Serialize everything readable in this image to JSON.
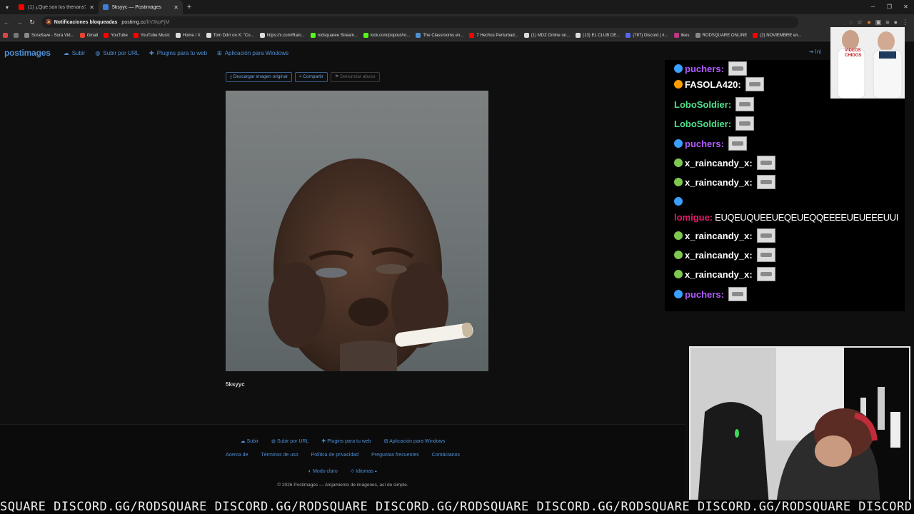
{
  "browser": {
    "tabs": [
      {
        "title": "(1) ¿Qué son los therians? - Yo",
        "favicon_color": "#ff0000",
        "active": false
      },
      {
        "title": "5ksyyc — Postimages",
        "favicon_color": "#3d7ed8",
        "active": true
      }
    ],
    "omnibox": {
      "blocked_label": "Notificaciones bloqueadas",
      "url_host": "postimg.cc",
      "url_path": "/kV3kpPjM"
    },
    "bookmarks": [
      {
        "label": "SoraSave - Sora Vid...",
        "icon_color": "#888888"
      },
      {
        "label": "Gmail",
        "icon_color": "#ea4335"
      },
      {
        "label": "YouTube",
        "icon_color": "#ff0000"
      },
      {
        "label": "YouTube Music",
        "icon_color": "#ff0000"
      },
      {
        "label": "Home / X",
        "icon_color": "#dddddd"
      },
      {
        "label": "Tom Ddrr on X: \"Co...",
        "icon_color": "#dddddd"
      },
      {
        "label": "https://x.com/Rain...",
        "icon_color": "#dddddd"
      },
      {
        "label": "rodsquaree Stream...",
        "icon_color": "#53fc18"
      },
      {
        "label": "kick.com/popout/ro...",
        "icon_color": "#53fc18"
      },
      {
        "label": "The Classrooms en...",
        "icon_color": "#4e8fd6"
      },
      {
        "label": "7 Hechos Perturbad...",
        "icon_color": "#ff0000"
      },
      {
        "label": "(1) MDZ Online on...",
        "icon_color": "#dddddd"
      },
      {
        "label": "(13) EL CLUB DE...",
        "icon_color": "#dddddd"
      },
      {
        "label": "(787) Discord | #...",
        "icon_color": "#5865f2"
      },
      {
        "label": "likes",
        "icon_color": "#c13584"
      },
      {
        "label": "RODSQUARE.ONLINE",
        "icon_color": "#888888"
      },
      {
        "label": "(2) NOVIEMBRE en...",
        "icon_color": "#ff0000"
      }
    ]
  },
  "site": {
    "logo": "postimages",
    "nav": [
      {
        "label": "Subir",
        "icon": "cloud-upload-icon"
      },
      {
        "label": "Subir por URL",
        "icon": "globe-icon"
      },
      {
        "label": "Plugins para tu web",
        "icon": "puzzle-icon"
      },
      {
        "label": "Aplicación para Windows",
        "icon": "windows-icon"
      }
    ],
    "nav_right": "Ini",
    "actions": {
      "download": "Descargar imagen original",
      "share": "Compartir",
      "report": "Denunciar abuso"
    },
    "image_caption": "5ksyyc",
    "footer": {
      "row1": [
        "Subir",
        "Subir por URL",
        "Plugins para tu web",
        "Aplicación para Windows"
      ],
      "row2": [
        "Acerca de",
        "Términos de uso",
        "Política de privacidad",
        "Preguntas frecuentes",
        "Contáctanos"
      ],
      "theme": "Modo claro",
      "language": "Idiomas",
      "copyright": "© 2026 Postimages — Alojamiento de imágenes, así de simple."
    },
    "accent_color": "#4e8fd6"
  },
  "chat": {
    "messages": [
      {
        "user": "puchers:",
        "color": "#b05cff",
        "emoji": "#3aa0ff",
        "emote": true,
        "text": ""
      },
      {
        "user": "FASOLA420:",
        "color": "#ffffff",
        "emoji": "#ff9d00",
        "emote": true,
        "text": ""
      },
      {
        "user": "LoboSoldier:",
        "color": "#4fe08a",
        "emoji": "",
        "emote": true,
        "text": ""
      },
      {
        "user": "LoboSoldier:",
        "color": "#4fe08a",
        "emoji": "",
        "emote": true,
        "text": ""
      },
      {
        "user": "puchers:",
        "color": "#b05cff",
        "emoji": "#3aa0ff",
        "emote": true,
        "text": ""
      },
      {
        "user": "x_raincandy_x:",
        "color": "#ffffff",
        "emoji": "#7ec850",
        "emote": true,
        "text": ""
      },
      {
        "user": "x_raincandy_x:",
        "color": "#ffffff",
        "emoji": "#7ec850",
        "emote": true,
        "text": ""
      },
      {
        "user": "",
        "color": "#ffffff",
        "emoji": "#3aa0ff",
        "emote": false,
        "text": ""
      },
      {
        "user": "lomigue:",
        "color": "#e8196a",
        "emoji": "",
        "emote": false,
        "text": "EUQEUQUEEUEQEUEQQEEEEUEUEEEUUI"
      },
      {
        "user": "x_raincandy_x:",
        "color": "#ffffff",
        "emoji": "#7ec850",
        "emote": true,
        "text": ""
      },
      {
        "user": "x_raincandy_x:",
        "color": "#ffffff",
        "emoji": "#7ec850",
        "emote": true,
        "text": ""
      },
      {
        "user": "x_raincandy_x:",
        "color": "#ffffff",
        "emoji": "#7ec850",
        "emote": true,
        "text": ""
      },
      {
        "user": "puchers:",
        "color": "#b05cff",
        "emoji": "#3aa0ff",
        "emote": true,
        "text": ""
      }
    ]
  },
  "promo": {
    "badge": "VIDEOS CHIDOS"
  },
  "ticker": "SQUARE DISCORD.GG/RODSQUARE DISCORD.GG/RODSQUARE DISCORD.GG/RODSQUARE DISCORD.GG/RODSQUARE DISCORD.GG/RODSQUARE DISCORD.GG/RO"
}
